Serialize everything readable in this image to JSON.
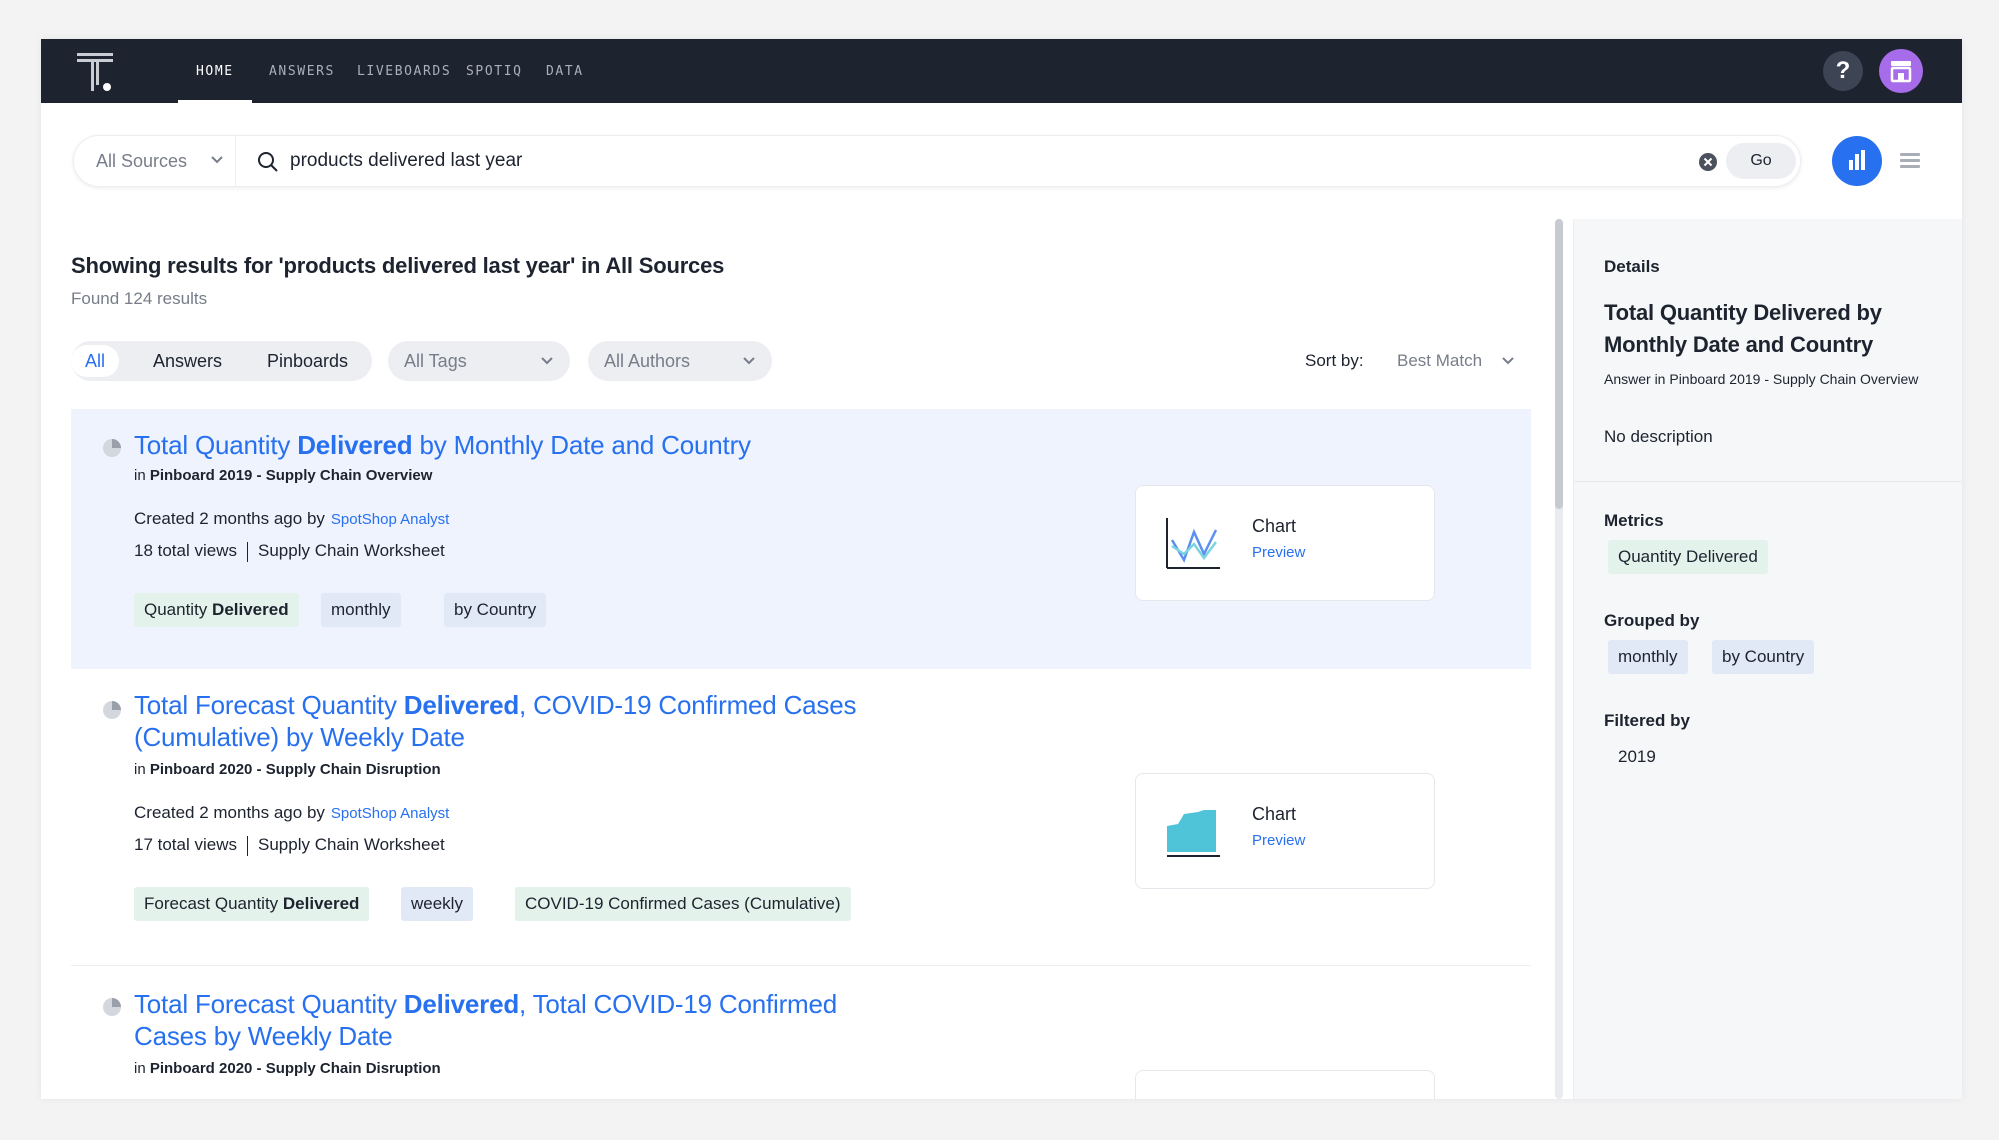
{
  "nav": {
    "items": [
      "HOME",
      "ANSWERS",
      "LIVEBOARDS",
      "SPOTIQ",
      "DATA"
    ],
    "active": "HOME",
    "help_label": "?"
  },
  "search": {
    "source": "All Sources",
    "query": "products delivered last year",
    "go_label": "Go"
  },
  "results_header": {
    "title": "Showing results for 'products delivered last year' in All Sources",
    "count": "Found 124 results"
  },
  "filters": {
    "types": [
      "All",
      "Answers",
      "Pinboards"
    ],
    "active_type": "All",
    "tags": "All Tags",
    "authors": "All Authors",
    "sort_label": "Sort by:",
    "sort_value": "Best Match"
  },
  "results": [
    {
      "title_pre": "Total Quantity ",
      "title_bold": "Delivered",
      "title_post": " by Monthly Date and Country",
      "pinboard_prefix": "in ",
      "pinboard": "Pinboard 2019 - Supply Chain Overview",
      "created": "Created 2 months ago by",
      "author": "SpotShop Analyst",
      "views": "18 total views",
      "worksheet": "Supply Chain Worksheet",
      "tags": [
        {
          "pre": "Quantity ",
          "bold": "Delivered",
          "kind": "metric"
        },
        {
          "pre": "monthly",
          "bold": "",
          "kind": "group"
        },
        {
          "pre": "by Country",
          "bold": "",
          "kind": "group"
        }
      ],
      "preview_type": "Chart",
      "preview_link": "Preview"
    },
    {
      "title_pre": "Total Forecast Quantity ",
      "title_bold": "Delivered",
      "title_line1_post": ", COVID-19 Confirmed Cases",
      "title_line2": "(Cumulative) by Weekly Date",
      "pinboard_prefix": "in ",
      "pinboard": "Pinboard 2020 - Supply Chain Disruption",
      "created": "Created 2 months ago by",
      "author": "SpotShop Analyst",
      "views": "17 total views",
      "worksheet": "Supply Chain Worksheet",
      "tags": [
        {
          "pre": "Forecast Quantity ",
          "bold": "Delivered",
          "kind": "metric"
        },
        {
          "pre": "weekly",
          "bold": "",
          "kind": "group"
        },
        {
          "pre": "COVID-19 Confirmed Cases (Cumulative)",
          "bold": "",
          "kind": "metric"
        }
      ],
      "preview_type": "Chart",
      "preview_link": "Preview"
    },
    {
      "title_pre": "Total Forecast Quantity ",
      "title_bold": "Delivered",
      "title_line1_post": ", Total COVID-19 Confirmed",
      "title_line2": "Cases by Weekly Date",
      "pinboard_prefix": "in ",
      "pinboard": "Pinboard 2020 - Supply Chain Disruption"
    }
  ],
  "details": {
    "label": "Details",
    "title": "Total Quantity Delivered by Monthly Date and Country",
    "subtitle": "Answer in Pinboard 2019 - Supply Chain Overview",
    "description": "No description",
    "metrics_label": "Metrics",
    "metrics": [
      "Quantity Delivered"
    ],
    "grouped_label": "Grouped by",
    "grouped": [
      "monthly",
      "by Country"
    ],
    "filtered_label": "Filtered by",
    "filtered": [
      "2019"
    ]
  },
  "colors": {
    "nav_bg": "#1d232f",
    "accent": "#2770ef",
    "avatar": "#a66cea",
    "metric_tag": "#e3f2ea",
    "group_tag": "#e1e8f6",
    "selected_row": "#eef3fd"
  }
}
